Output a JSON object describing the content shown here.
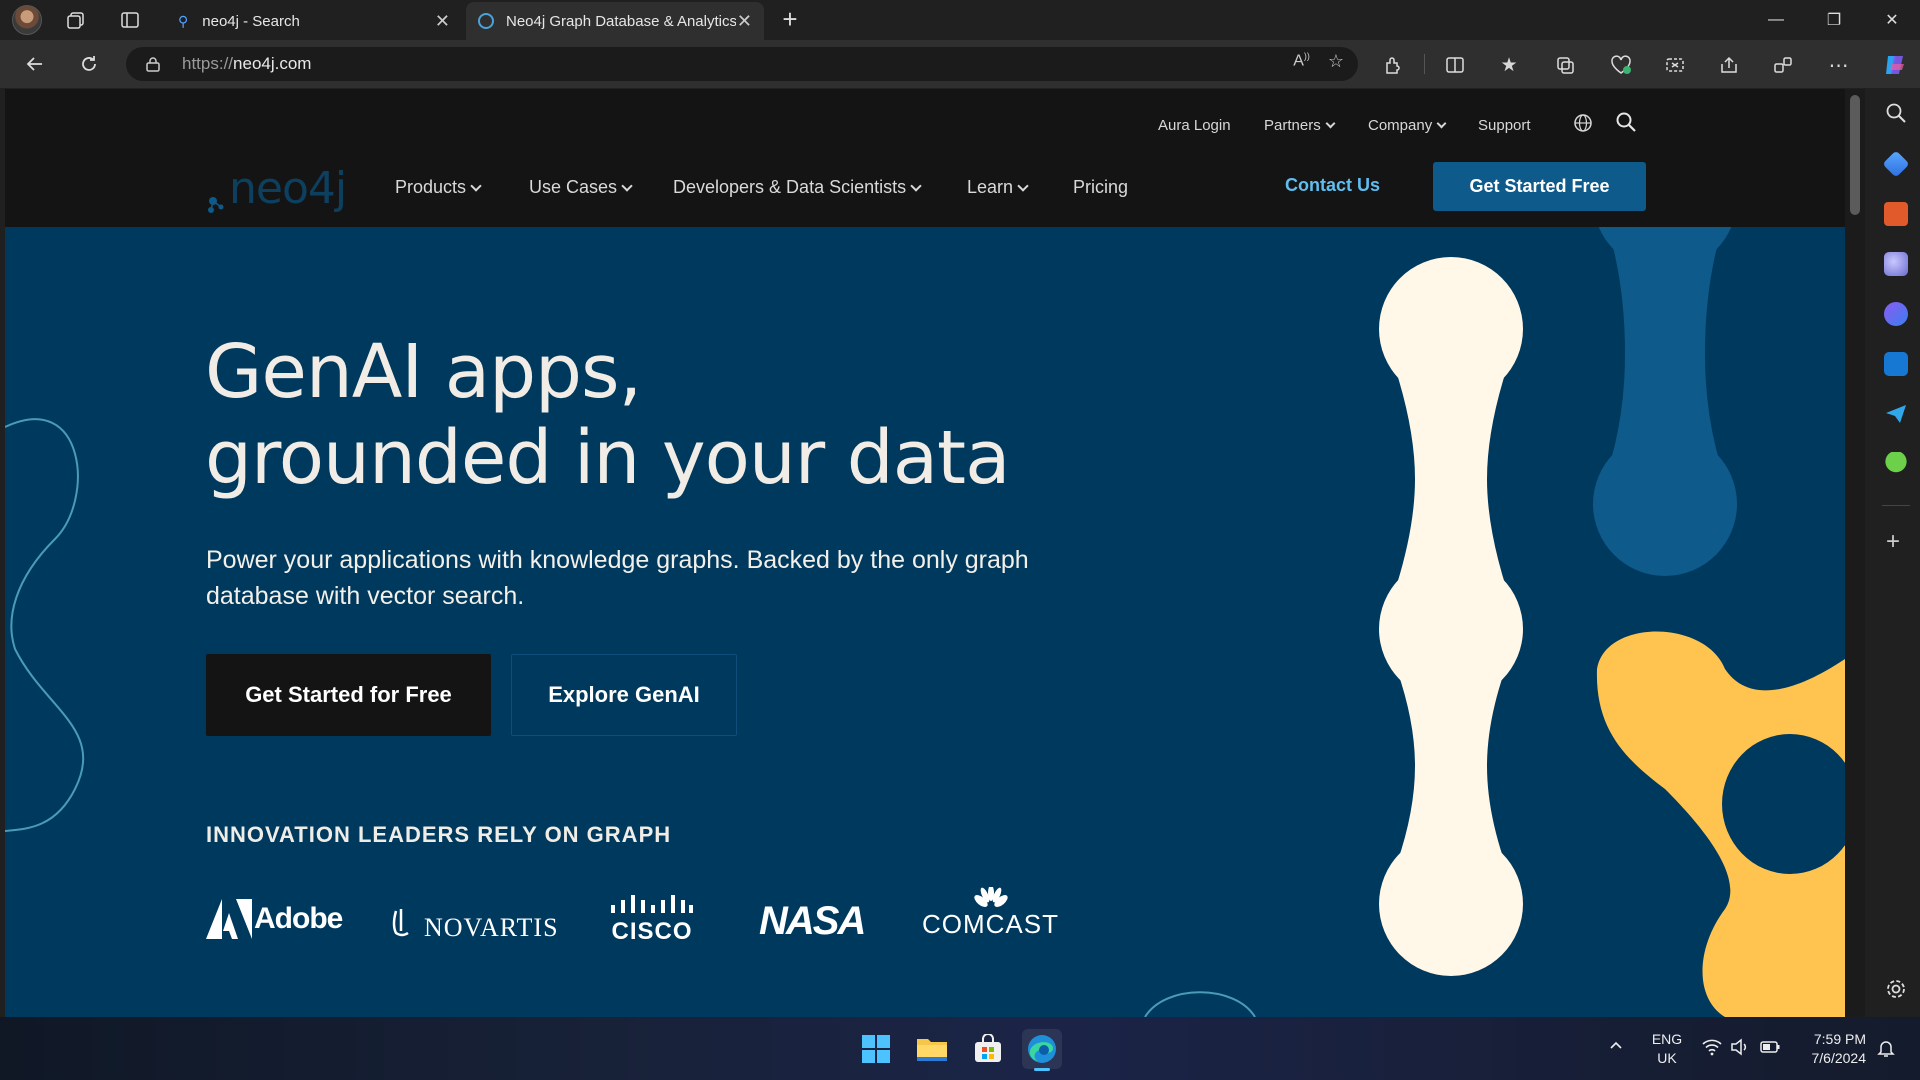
{
  "browser": {
    "tabs": [
      {
        "title": "neo4j - Search",
        "active": false
      },
      {
        "title": "Neo4j Graph Database & Analytics",
        "active": true
      }
    ],
    "url_protocol": "https://",
    "url_host": "neo4j.com"
  },
  "site": {
    "util_nav": {
      "aura_login": "Aura Login",
      "partners": "Partners",
      "company": "Company",
      "support": "Support"
    },
    "logo_text": "neo4j",
    "main_nav": {
      "products": "Products",
      "use_cases": "Use Cases",
      "developers": "Developers & Data Scientists",
      "learn": "Learn",
      "pricing": "Pricing"
    },
    "contact": "Contact Us",
    "get_started": "Get Started Free"
  },
  "hero": {
    "title_line1": "GenAI apps,",
    "title_line2": "grounded in your data",
    "subtitle": "Power your applications with knowledge graphs. Backed by the only graph database with vector search.",
    "cta_primary": "Get Started for Free",
    "cta_secondary": "Explore GenAI",
    "innovation_heading": "INNOVATION LEADERS RELY ON GRAPH",
    "brands": {
      "adobe": "Adobe",
      "novartis": "NOVARTIS",
      "cisco": "CISCO",
      "nasa": "NASA",
      "comcast": "COMCAST"
    }
  },
  "taskbar": {
    "lang1": "ENG",
    "lang2": "UK",
    "time": "7:59 PM",
    "date": "7/6/2024"
  },
  "colors": {
    "hero_bg": "#00395e",
    "header_bg": "#141414",
    "accent_blue": "#0e5a8a",
    "cream": "#fff7e8",
    "yellow": "#ffc450"
  }
}
